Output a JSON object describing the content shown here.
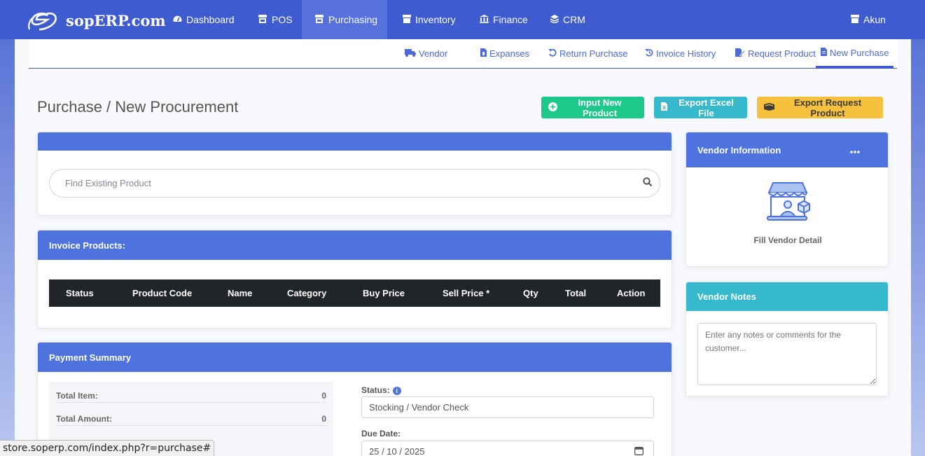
{
  "brand": {
    "name": "sopERP.com"
  },
  "topnav": {
    "items": [
      {
        "label": "Dashboard",
        "icon": "tachometer-icon"
      },
      {
        "label": "POS",
        "icon": "store-icon"
      },
      {
        "label": "Purchasing",
        "icon": "store-icon",
        "active": true
      },
      {
        "label": "Inventory",
        "icon": "box-icon"
      },
      {
        "label": "Finance",
        "icon": "bank-icon"
      },
      {
        "label": "CRM",
        "icon": "layers-icon"
      }
    ],
    "account_label": "Akun"
  },
  "subnav": {
    "items": [
      {
        "label": "Vendor",
        "icon": "truck-icon"
      },
      {
        "label": "Expanses",
        "icon": "file-invoice-icon"
      },
      {
        "label": "Return Purchase",
        "icon": "undo-icon"
      },
      {
        "label": "Invoice History",
        "icon": "history-icon"
      },
      {
        "label": "Request Product",
        "icon": "edit-file-icon"
      },
      {
        "label": "New Purchase",
        "icon": "file-icon",
        "active": true
      }
    ]
  },
  "page": {
    "title": "Purchase / New Procurement"
  },
  "actions": {
    "input_new_product": "Input New Product",
    "export_excel": "Export Excel File",
    "export_request": "Export Request Product"
  },
  "search": {
    "placeholder": "Find Existing Product"
  },
  "invoice": {
    "title": "Invoice Products:",
    "columns": [
      "Status",
      "Product Code",
      "Name",
      "Category",
      "Buy Price",
      "Sell Price *",
      "Qty",
      "Total",
      "Action"
    ]
  },
  "payment": {
    "title": "Payment Summary",
    "rows": [
      {
        "label": "Total Item:",
        "value": "0"
      },
      {
        "label": "Total Amount:",
        "value": "0"
      }
    ],
    "status_label": "Status:",
    "status_value": "Stocking / Vendor Check",
    "due_label": "Due Date:",
    "due_value": "25 / 10 / 2025"
  },
  "vendor": {
    "title": "Vendor Information",
    "fill_label": "Fill Vendor Detail"
  },
  "notes": {
    "title": "Vendor Notes",
    "placeholder": "Enter any notes or comments for the customer..."
  },
  "statusbar": {
    "url": "store.soperp.com/index.php?r=purchase#"
  },
  "colors": {
    "primary": "#4e73df",
    "navbar": "#3f5bd0",
    "success": "#1cc88a",
    "info": "#36b9cc",
    "warning": "#f6c23e",
    "table_head": "#212529"
  }
}
